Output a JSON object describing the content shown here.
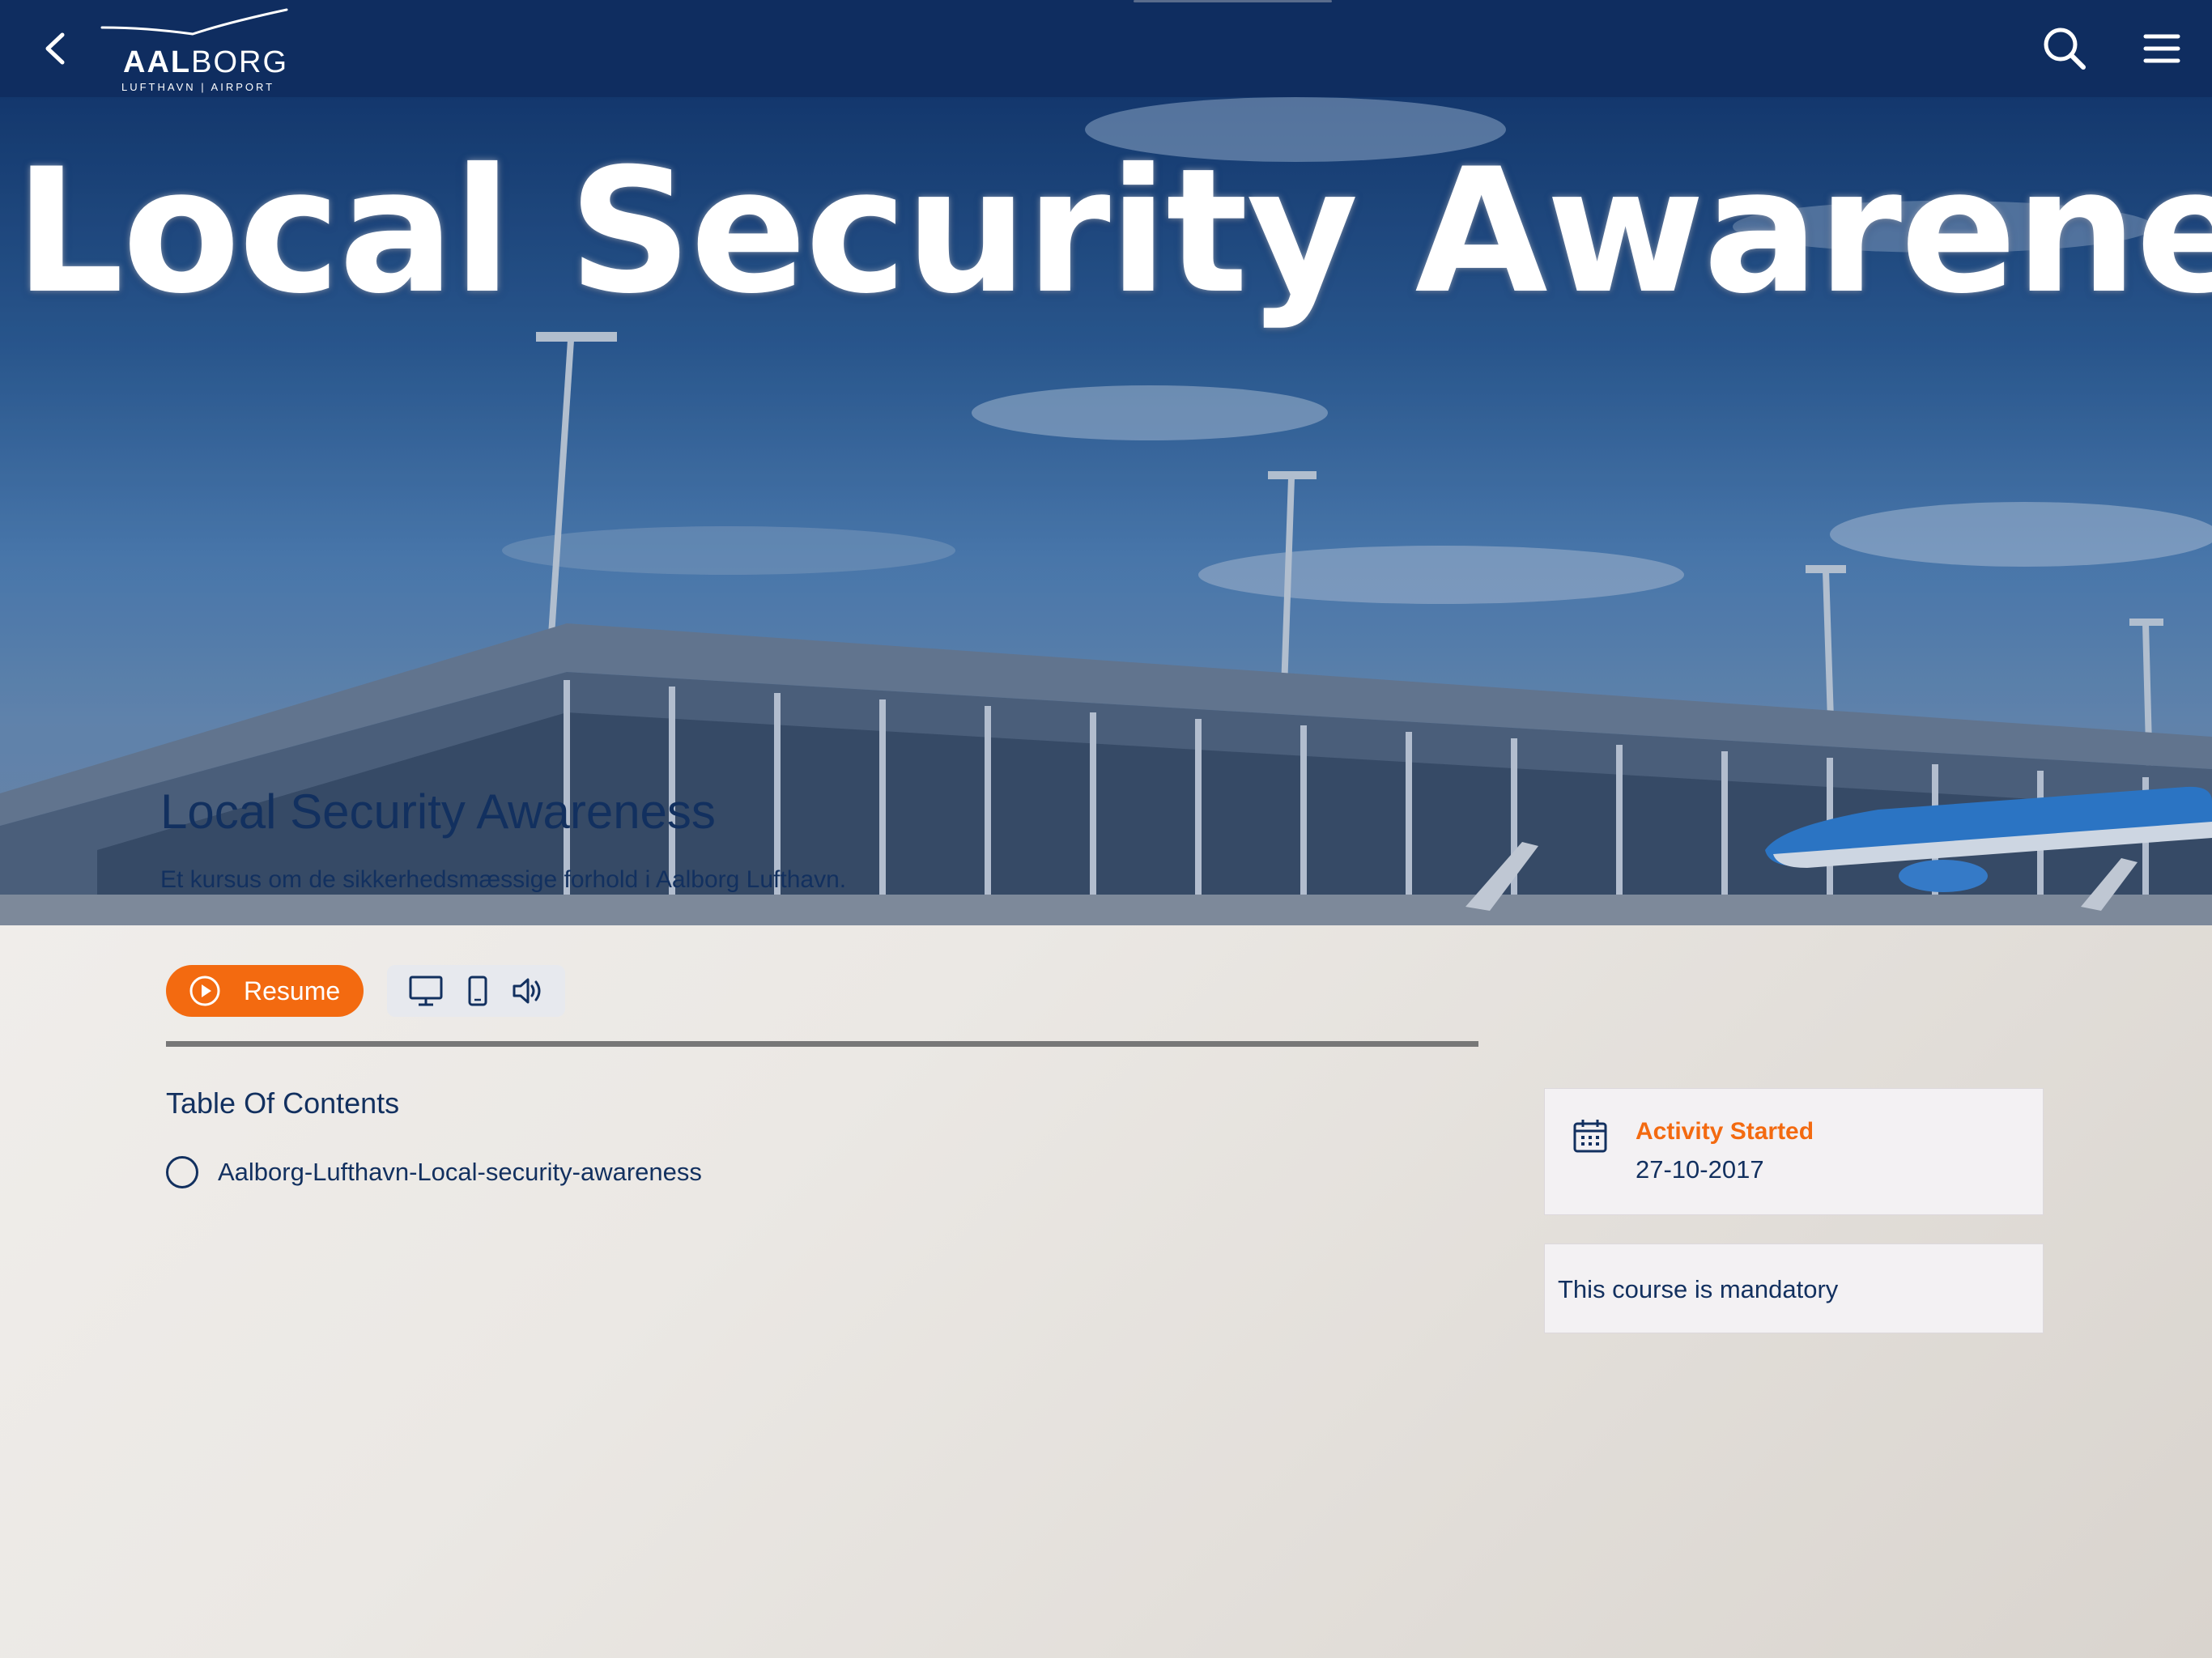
{
  "topbar": {
    "logo_brand_bold": "AAL",
    "logo_brand_regular": "BORG",
    "logo_sub": "LUFTHAVN | AIRPORT",
    "icons": {
      "back": "chevron-left-icon",
      "search": "search-icon",
      "menu": "hamburger-menu-icon"
    },
    "background_color": "#0f2d60"
  },
  "hero": {
    "banner_text": "Local Security Awareness",
    "course_title": "Local Security Awareness",
    "course_description": "Et kursus om de sikkerhedsmæssige forhold i Aalborg Lufthavn."
  },
  "actions": {
    "resume_label": "Resume",
    "resume_color": "#f36a10",
    "device_icons": [
      "desktop-icon",
      "tablet-icon",
      "speaker-icon"
    ]
  },
  "toc": {
    "title": "Table Of Contents",
    "items": [
      {
        "label": "Aalborg-Lufthavn-Local-security-awareness",
        "status": "not-started"
      }
    ]
  },
  "sidebar": {
    "activity_label": "Activity Started",
    "activity_date": "27-10-2017",
    "mandatory_text": "This course is mandatory"
  },
  "colors": {
    "primary_navy": "#12305f",
    "accent_orange": "#f36a10"
  }
}
